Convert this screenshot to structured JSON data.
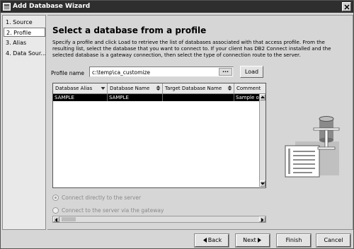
{
  "window": {
    "title": "Add Database Wizard"
  },
  "steps": [
    {
      "label": "1. Source",
      "active": false
    },
    {
      "label": "2. Profile",
      "active": true
    },
    {
      "label": "3. Alias",
      "active": false
    },
    {
      "label": "4. Data Sour...",
      "active": false
    }
  ],
  "page": {
    "heading": "Select a database from a profile",
    "description": "Specify a profile and click Load to retrieve the list of databases associated with that access profile. From the resulting list, select the database that you want to connect to. If your client has DB2 Connect installed and the selected database is a gateway connection, then select the type of connection route to the server."
  },
  "profile": {
    "label": "Profile name",
    "value": "c:\\temp\\ca_customize",
    "browse_label": "...",
    "load_label": "Load"
  },
  "table": {
    "columns": [
      "Database Alias",
      "Database Name",
      "Target Database Name",
      "Comment"
    ],
    "rows": [
      {
        "alias": "SAMPLE",
        "name": "SAMPLE",
        "target": "",
        "comment": "Sample on",
        "selected": true
      }
    ]
  },
  "connection": {
    "option1": "Connect directly to the server",
    "option2": "Connect to the server via the gateway",
    "selected": "option1",
    "enabled": false
  },
  "buttons": {
    "back": "Back",
    "next": "Next",
    "finish": "Finish",
    "cancel": "Cancel"
  },
  "icons": {
    "app": "wizard-icon",
    "close": "close-icon",
    "illustration": "database-profile-illustration"
  }
}
